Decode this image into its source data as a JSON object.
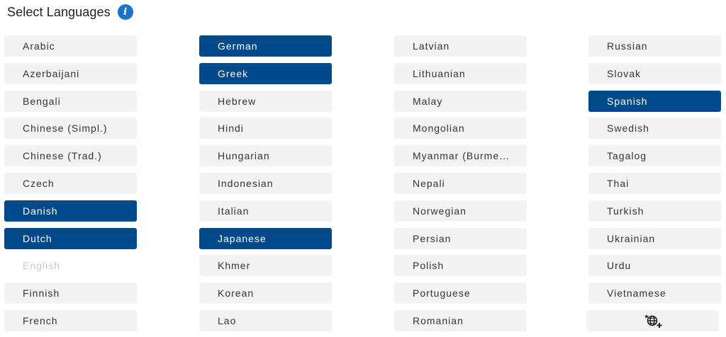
{
  "header": {
    "title": "Select Languages",
    "info_icon": "info-icon"
  },
  "colors": {
    "selected_bg": "#00498a",
    "chip_bg": "#f3f3f3",
    "disabled_text": "#c8c8c8",
    "info_blue": "#1a73c8"
  },
  "columns": [
    {
      "items": [
        {
          "label": "Arabic",
          "state": "normal"
        },
        {
          "label": "Azerbaijani",
          "state": "normal"
        },
        {
          "label": "Bengali",
          "state": "normal"
        },
        {
          "label": "Chinese (Simpl.)",
          "state": "normal"
        },
        {
          "label": "Chinese (Trad.)",
          "state": "normal"
        },
        {
          "label": "Czech",
          "state": "normal"
        },
        {
          "label": "Danish",
          "state": "selected"
        },
        {
          "label": "Dutch",
          "state": "selected"
        },
        {
          "label": "English",
          "state": "disabled"
        },
        {
          "label": "Finnish",
          "state": "normal"
        },
        {
          "label": "French",
          "state": "normal"
        }
      ]
    },
    {
      "items": [
        {
          "label": "German",
          "state": "selected"
        },
        {
          "label": "Greek",
          "state": "selected"
        },
        {
          "label": "Hebrew",
          "state": "normal"
        },
        {
          "label": "Hindi",
          "state": "normal"
        },
        {
          "label": "Hungarian",
          "state": "normal"
        },
        {
          "label": "Indonesian",
          "state": "normal"
        },
        {
          "label": "Italian",
          "state": "normal"
        },
        {
          "label": "Japanese",
          "state": "selected"
        },
        {
          "label": "Khmer",
          "state": "normal"
        },
        {
          "label": "Korean",
          "state": "normal"
        },
        {
          "label": "Lao",
          "state": "normal"
        }
      ]
    },
    {
      "items": [
        {
          "label": "Latvian",
          "state": "normal"
        },
        {
          "label": "Lithuanian",
          "state": "normal"
        },
        {
          "label": "Malay",
          "state": "normal"
        },
        {
          "label": "Mongolian",
          "state": "normal"
        },
        {
          "label": "Myanmar (Burme…",
          "state": "normal"
        },
        {
          "label": "Nepali",
          "state": "normal"
        },
        {
          "label": "Norwegian",
          "state": "normal"
        },
        {
          "label": "Persian",
          "state": "normal"
        },
        {
          "label": "Polish",
          "state": "normal"
        },
        {
          "label": "Portuguese",
          "state": "normal"
        },
        {
          "label": "Romanian",
          "state": "normal"
        }
      ]
    },
    {
      "items": [
        {
          "label": "Russian",
          "state": "normal"
        },
        {
          "label": "Slovak",
          "state": "normal"
        },
        {
          "label": "Spanish",
          "state": "selected"
        },
        {
          "label": "Swedish",
          "state": "normal"
        },
        {
          "label": "Tagalog",
          "state": "normal"
        },
        {
          "label": "Thai",
          "state": "normal"
        },
        {
          "label": "Turkish",
          "state": "normal"
        },
        {
          "label": "Ukrainian",
          "state": "normal"
        },
        {
          "label": "Urdu",
          "state": "normal"
        },
        {
          "label": "Vietnamese",
          "state": "normal"
        },
        {
          "label": "",
          "state": "icon",
          "icon": "add-language-globe-icon"
        }
      ]
    }
  ]
}
